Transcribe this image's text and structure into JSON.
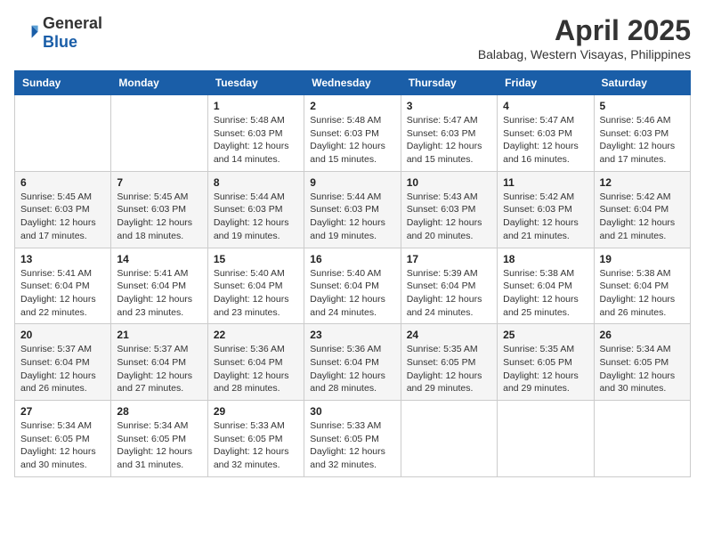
{
  "header": {
    "logo_general": "General",
    "logo_blue": "Blue",
    "month_title": "April 2025",
    "location": "Balabag, Western Visayas, Philippines"
  },
  "days_of_week": [
    "Sunday",
    "Monday",
    "Tuesday",
    "Wednesday",
    "Thursday",
    "Friday",
    "Saturday"
  ],
  "weeks": [
    [
      {
        "day": "",
        "info": ""
      },
      {
        "day": "",
        "info": ""
      },
      {
        "day": "1",
        "sunrise": "5:48 AM",
        "sunset": "6:03 PM",
        "daylight": "12 hours and 14 minutes."
      },
      {
        "day": "2",
        "sunrise": "5:48 AM",
        "sunset": "6:03 PM",
        "daylight": "12 hours and 15 minutes."
      },
      {
        "day": "3",
        "sunrise": "5:47 AM",
        "sunset": "6:03 PM",
        "daylight": "12 hours and 15 minutes."
      },
      {
        "day": "4",
        "sunrise": "5:47 AM",
        "sunset": "6:03 PM",
        "daylight": "12 hours and 16 minutes."
      },
      {
        "day": "5",
        "sunrise": "5:46 AM",
        "sunset": "6:03 PM",
        "daylight": "12 hours and 17 minutes."
      }
    ],
    [
      {
        "day": "6",
        "sunrise": "5:45 AM",
        "sunset": "6:03 PM",
        "daylight": "12 hours and 17 minutes."
      },
      {
        "day": "7",
        "sunrise": "5:45 AM",
        "sunset": "6:03 PM",
        "daylight": "12 hours and 18 minutes."
      },
      {
        "day": "8",
        "sunrise": "5:44 AM",
        "sunset": "6:03 PM",
        "daylight": "12 hours and 19 minutes."
      },
      {
        "day": "9",
        "sunrise": "5:44 AM",
        "sunset": "6:03 PM",
        "daylight": "12 hours and 19 minutes."
      },
      {
        "day": "10",
        "sunrise": "5:43 AM",
        "sunset": "6:03 PM",
        "daylight": "12 hours and 20 minutes."
      },
      {
        "day": "11",
        "sunrise": "5:42 AM",
        "sunset": "6:03 PM",
        "daylight": "12 hours and 21 minutes."
      },
      {
        "day": "12",
        "sunrise": "5:42 AM",
        "sunset": "6:04 PM",
        "daylight": "12 hours and 21 minutes."
      }
    ],
    [
      {
        "day": "13",
        "sunrise": "5:41 AM",
        "sunset": "6:04 PM",
        "daylight": "12 hours and 22 minutes."
      },
      {
        "day": "14",
        "sunrise": "5:41 AM",
        "sunset": "6:04 PM",
        "daylight": "12 hours and 23 minutes."
      },
      {
        "day": "15",
        "sunrise": "5:40 AM",
        "sunset": "6:04 PM",
        "daylight": "12 hours and 23 minutes."
      },
      {
        "day": "16",
        "sunrise": "5:40 AM",
        "sunset": "6:04 PM",
        "daylight": "12 hours and 24 minutes."
      },
      {
        "day": "17",
        "sunrise": "5:39 AM",
        "sunset": "6:04 PM",
        "daylight": "12 hours and 24 minutes."
      },
      {
        "day": "18",
        "sunrise": "5:38 AM",
        "sunset": "6:04 PM",
        "daylight": "12 hours and 25 minutes."
      },
      {
        "day": "19",
        "sunrise": "5:38 AM",
        "sunset": "6:04 PM",
        "daylight": "12 hours and 26 minutes."
      }
    ],
    [
      {
        "day": "20",
        "sunrise": "5:37 AM",
        "sunset": "6:04 PM",
        "daylight": "12 hours and 26 minutes."
      },
      {
        "day": "21",
        "sunrise": "5:37 AM",
        "sunset": "6:04 PM",
        "daylight": "12 hours and 27 minutes."
      },
      {
        "day": "22",
        "sunrise": "5:36 AM",
        "sunset": "6:04 PM",
        "daylight": "12 hours and 28 minutes."
      },
      {
        "day": "23",
        "sunrise": "5:36 AM",
        "sunset": "6:04 PM",
        "daylight": "12 hours and 28 minutes."
      },
      {
        "day": "24",
        "sunrise": "5:35 AM",
        "sunset": "6:05 PM",
        "daylight": "12 hours and 29 minutes."
      },
      {
        "day": "25",
        "sunrise": "5:35 AM",
        "sunset": "6:05 PM",
        "daylight": "12 hours and 29 minutes."
      },
      {
        "day": "26",
        "sunrise": "5:34 AM",
        "sunset": "6:05 PM",
        "daylight": "12 hours and 30 minutes."
      }
    ],
    [
      {
        "day": "27",
        "sunrise": "5:34 AM",
        "sunset": "6:05 PM",
        "daylight": "12 hours and 30 minutes."
      },
      {
        "day": "28",
        "sunrise": "5:34 AM",
        "sunset": "6:05 PM",
        "daylight": "12 hours and 31 minutes."
      },
      {
        "day": "29",
        "sunrise": "5:33 AM",
        "sunset": "6:05 PM",
        "daylight": "12 hours and 32 minutes."
      },
      {
        "day": "30",
        "sunrise": "5:33 AM",
        "sunset": "6:05 PM",
        "daylight": "12 hours and 32 minutes."
      },
      {
        "day": "",
        "info": ""
      },
      {
        "day": "",
        "info": ""
      },
      {
        "day": "",
        "info": ""
      }
    ]
  ]
}
